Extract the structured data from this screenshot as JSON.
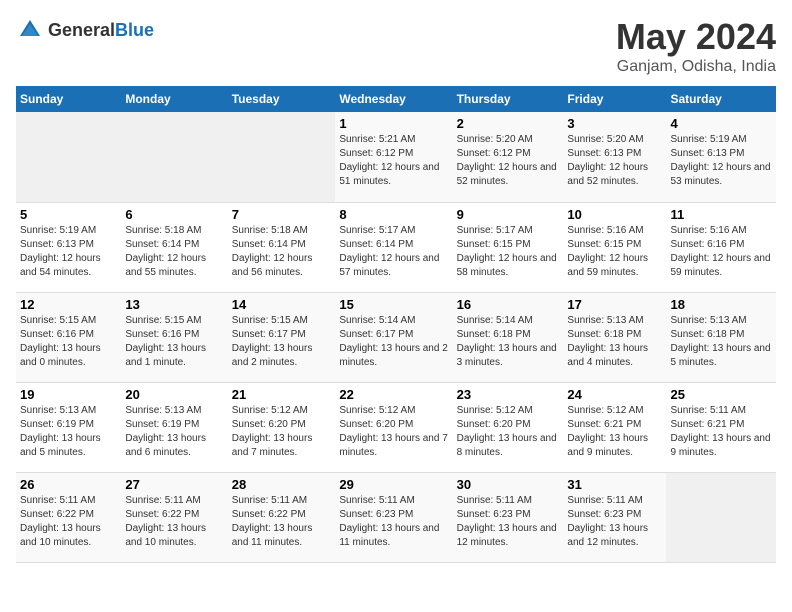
{
  "logo": {
    "text_general": "General",
    "text_blue": "Blue"
  },
  "title": "May 2024",
  "subtitle": "Ganjam, Odisha, India",
  "days_header": [
    "Sunday",
    "Monday",
    "Tuesday",
    "Wednesday",
    "Thursday",
    "Friday",
    "Saturday"
  ],
  "weeks": [
    [
      {
        "day": "",
        "sunrise": "",
        "sunset": "",
        "daylight": "",
        "empty": true
      },
      {
        "day": "",
        "sunrise": "",
        "sunset": "",
        "daylight": "",
        "empty": true
      },
      {
        "day": "",
        "sunrise": "",
        "sunset": "",
        "daylight": "",
        "empty": true
      },
      {
        "day": "1",
        "sunrise": "Sunrise: 5:21 AM",
        "sunset": "Sunset: 6:12 PM",
        "daylight": "Daylight: 12 hours and 51 minutes."
      },
      {
        "day": "2",
        "sunrise": "Sunrise: 5:20 AM",
        "sunset": "Sunset: 6:12 PM",
        "daylight": "Daylight: 12 hours and 52 minutes."
      },
      {
        "day": "3",
        "sunrise": "Sunrise: 5:20 AM",
        "sunset": "Sunset: 6:13 PM",
        "daylight": "Daylight: 12 hours and 52 minutes."
      },
      {
        "day": "4",
        "sunrise": "Sunrise: 5:19 AM",
        "sunset": "Sunset: 6:13 PM",
        "daylight": "Daylight: 12 hours and 53 minutes."
      }
    ],
    [
      {
        "day": "5",
        "sunrise": "Sunrise: 5:19 AM",
        "sunset": "Sunset: 6:13 PM",
        "daylight": "Daylight: 12 hours and 54 minutes."
      },
      {
        "day": "6",
        "sunrise": "Sunrise: 5:18 AM",
        "sunset": "Sunset: 6:14 PM",
        "daylight": "Daylight: 12 hours and 55 minutes."
      },
      {
        "day": "7",
        "sunrise": "Sunrise: 5:18 AM",
        "sunset": "Sunset: 6:14 PM",
        "daylight": "Daylight: 12 hours and 56 minutes."
      },
      {
        "day": "8",
        "sunrise": "Sunrise: 5:17 AM",
        "sunset": "Sunset: 6:14 PM",
        "daylight": "Daylight: 12 hours and 57 minutes."
      },
      {
        "day": "9",
        "sunrise": "Sunrise: 5:17 AM",
        "sunset": "Sunset: 6:15 PM",
        "daylight": "Daylight: 12 hours and 58 minutes."
      },
      {
        "day": "10",
        "sunrise": "Sunrise: 5:16 AM",
        "sunset": "Sunset: 6:15 PM",
        "daylight": "Daylight: 12 hours and 59 minutes."
      },
      {
        "day": "11",
        "sunrise": "Sunrise: 5:16 AM",
        "sunset": "Sunset: 6:16 PM",
        "daylight": "Daylight: 12 hours and 59 minutes."
      }
    ],
    [
      {
        "day": "12",
        "sunrise": "Sunrise: 5:15 AM",
        "sunset": "Sunset: 6:16 PM",
        "daylight": "Daylight: 13 hours and 0 minutes."
      },
      {
        "day": "13",
        "sunrise": "Sunrise: 5:15 AM",
        "sunset": "Sunset: 6:16 PM",
        "daylight": "Daylight: 13 hours and 1 minute."
      },
      {
        "day": "14",
        "sunrise": "Sunrise: 5:15 AM",
        "sunset": "Sunset: 6:17 PM",
        "daylight": "Daylight: 13 hours and 2 minutes."
      },
      {
        "day": "15",
        "sunrise": "Sunrise: 5:14 AM",
        "sunset": "Sunset: 6:17 PM",
        "daylight": "Daylight: 13 hours and 2 minutes."
      },
      {
        "day": "16",
        "sunrise": "Sunrise: 5:14 AM",
        "sunset": "Sunset: 6:18 PM",
        "daylight": "Daylight: 13 hours and 3 minutes."
      },
      {
        "day": "17",
        "sunrise": "Sunrise: 5:13 AM",
        "sunset": "Sunset: 6:18 PM",
        "daylight": "Daylight: 13 hours and 4 minutes."
      },
      {
        "day": "18",
        "sunrise": "Sunrise: 5:13 AM",
        "sunset": "Sunset: 6:18 PM",
        "daylight": "Daylight: 13 hours and 5 minutes."
      }
    ],
    [
      {
        "day": "19",
        "sunrise": "Sunrise: 5:13 AM",
        "sunset": "Sunset: 6:19 PM",
        "daylight": "Daylight: 13 hours and 5 minutes."
      },
      {
        "day": "20",
        "sunrise": "Sunrise: 5:13 AM",
        "sunset": "Sunset: 6:19 PM",
        "daylight": "Daylight: 13 hours and 6 minutes."
      },
      {
        "day": "21",
        "sunrise": "Sunrise: 5:12 AM",
        "sunset": "Sunset: 6:20 PM",
        "daylight": "Daylight: 13 hours and 7 minutes."
      },
      {
        "day": "22",
        "sunrise": "Sunrise: 5:12 AM",
        "sunset": "Sunset: 6:20 PM",
        "daylight": "Daylight: 13 hours and 7 minutes."
      },
      {
        "day": "23",
        "sunrise": "Sunrise: 5:12 AM",
        "sunset": "Sunset: 6:20 PM",
        "daylight": "Daylight: 13 hours and 8 minutes."
      },
      {
        "day": "24",
        "sunrise": "Sunrise: 5:12 AM",
        "sunset": "Sunset: 6:21 PM",
        "daylight": "Daylight: 13 hours and 9 minutes."
      },
      {
        "day": "25",
        "sunrise": "Sunrise: 5:11 AM",
        "sunset": "Sunset: 6:21 PM",
        "daylight": "Daylight: 13 hours and 9 minutes."
      }
    ],
    [
      {
        "day": "26",
        "sunrise": "Sunrise: 5:11 AM",
        "sunset": "Sunset: 6:22 PM",
        "daylight": "Daylight: 13 hours and 10 minutes."
      },
      {
        "day": "27",
        "sunrise": "Sunrise: 5:11 AM",
        "sunset": "Sunset: 6:22 PM",
        "daylight": "Daylight: 13 hours and 10 minutes."
      },
      {
        "day": "28",
        "sunrise": "Sunrise: 5:11 AM",
        "sunset": "Sunset: 6:22 PM",
        "daylight": "Daylight: 13 hours and 11 minutes."
      },
      {
        "day": "29",
        "sunrise": "Sunrise: 5:11 AM",
        "sunset": "Sunset: 6:23 PM",
        "daylight": "Daylight: 13 hours and 11 minutes."
      },
      {
        "day": "30",
        "sunrise": "Sunrise: 5:11 AM",
        "sunset": "Sunset: 6:23 PM",
        "daylight": "Daylight: 13 hours and 12 minutes."
      },
      {
        "day": "31",
        "sunrise": "Sunrise: 5:11 AM",
        "sunset": "Sunset: 6:23 PM",
        "daylight": "Daylight: 13 hours and 12 minutes."
      },
      {
        "day": "",
        "sunrise": "",
        "sunset": "",
        "daylight": "",
        "empty": true
      }
    ]
  ]
}
